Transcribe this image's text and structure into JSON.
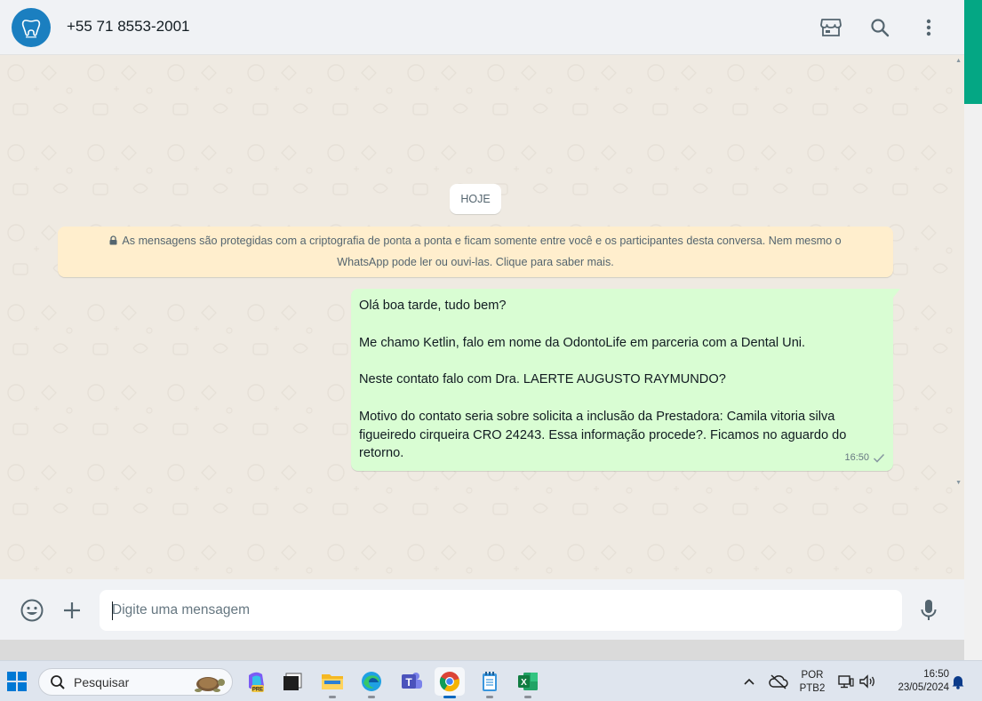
{
  "header": {
    "contact_name": "+55 71 8553-2001",
    "icons": [
      "catalog-icon",
      "search-icon",
      "menu-icon"
    ]
  },
  "chat": {
    "date_chip": "HOJE",
    "encryption_notice": {
      "line1": "As mensagens são protegidas com a criptografia de ponta a ponta e ficam somente entre você e os participantes desta conversa. Nem mesmo o",
      "line2": "WhatsApp pode ler ou ouvi-las. Clique para saber mais."
    },
    "message": {
      "p1": "Olá boa tarde, tudo bem?",
      "p2": "Me chamo Ketlin, falo em nome da OdontoLife em parceria com a Dental Uni.",
      "p3": "Neste contato falo com Dra. LAERTE AUGUSTO RAYMUNDO?",
      "p4_line1": "Motivo do contato seria sobre solicita a inclusão da Prestadora: Camila vitoria silva",
      "p4_line2": "figueiredo cirqueira CRO 24243. Essa informação procede?. Ficamos no aguardo do",
      "p4_line3": "retorno.",
      "time": "16:50",
      "status": "sent"
    }
  },
  "composer": {
    "placeholder": "Digite uma mensagem",
    "value": ""
  },
  "taskbar": {
    "search_label": "Pesquisar",
    "language": "POR",
    "layout": "PTB2",
    "time": "16:50",
    "date": "23/05/2024",
    "apps": [
      "copilot-icon",
      "terminal-icon",
      "file-explorer-icon",
      "edge-icon",
      "teams-icon",
      "chrome-icon",
      "notepad-icon",
      "excel-icon"
    ]
  },
  "colors": {
    "accent": "#04a784",
    "bubble_out": "#d9fdd3",
    "notice": "#ffeecd",
    "avatar_bg": "#1b7fc0"
  }
}
